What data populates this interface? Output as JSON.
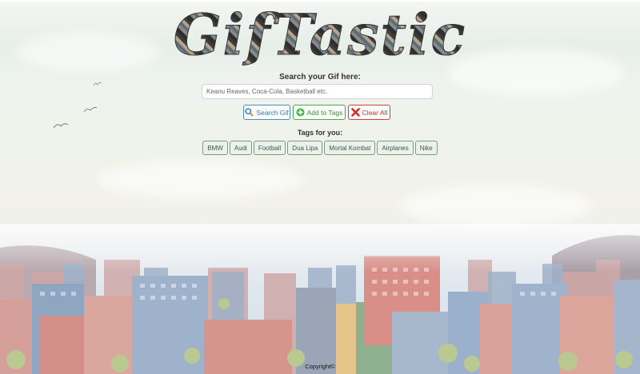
{
  "logo": {
    "text": "GifTastic"
  },
  "search": {
    "label": "Search your Gif here:",
    "placeholder": "Keanu Reaves, Coca-Cola, Basketball etc."
  },
  "buttons": {
    "search_label": "Search Gif",
    "add_label": "Add to Tags",
    "clear_label": "Clear All"
  },
  "tags": {
    "label": "Tags for you:",
    "items": [
      "BMW",
      "Audi",
      "Football",
      "Dua Lipa",
      "Mortal Kombat",
      "Airplanes",
      "Nike"
    ]
  },
  "footer": {
    "text": "Copyright©"
  },
  "colors": {
    "search_accent": "#2f7fb2",
    "add_accent": "#3e8e3e",
    "clear_accent": "#c03a3a",
    "tag_border": "#7b9a86"
  },
  "icons": {
    "search": "magnifier-icon",
    "add": "plus-circle-icon",
    "clear": "x-icon"
  }
}
